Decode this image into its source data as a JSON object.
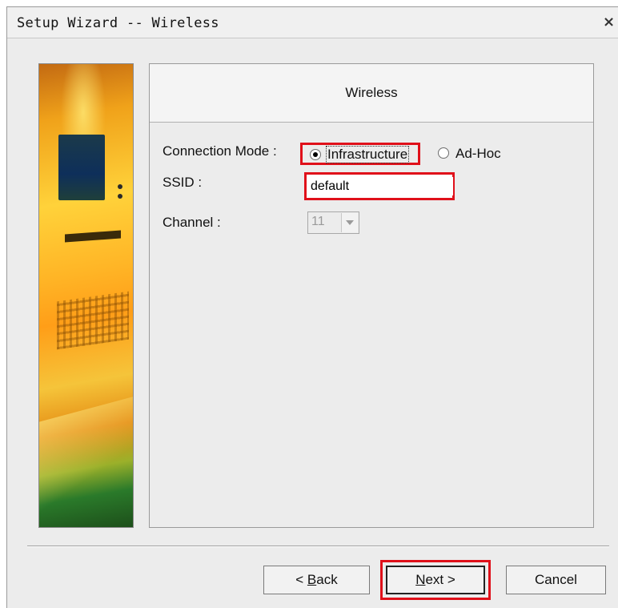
{
  "window": {
    "title": "Setup Wizard -- Wireless",
    "close_glyph": "×"
  },
  "panel": {
    "title": "Wireless"
  },
  "form": {
    "connection_mode_label": "Connection Mode :",
    "modes": [
      {
        "label": "Infrastructure",
        "selected": true
      },
      {
        "label": "Ad-Hoc",
        "selected": false
      }
    ],
    "ssid_label": "SSID :",
    "ssid_value": "default",
    "channel_label": "Channel :",
    "channel_value": "11",
    "channel_enabled": false
  },
  "buttons": {
    "back": {
      "prefix": "< ",
      "mnemonic": "B",
      "rest": "ack"
    },
    "next": {
      "mnemonic": "N",
      "rest": "ext >"
    },
    "cancel": "Cancel"
  },
  "colors": {
    "highlight": "#e0101a",
    "background": "#ececec"
  },
  "icons": {
    "close": "close-icon",
    "channel_dropdown": "chevron-down-icon"
  }
}
